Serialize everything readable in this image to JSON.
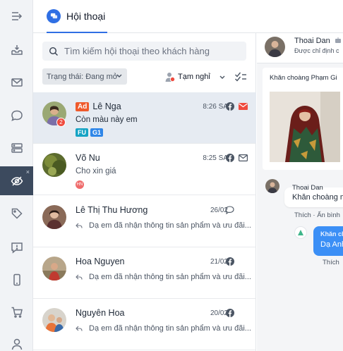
{
  "header": {
    "tab_label": "Hội thoại"
  },
  "sidebar": {
    "items": [
      {
        "icon": "collapse-menu-icon"
      },
      {
        "icon": "inbox-icon"
      },
      {
        "icon": "mail-icon"
      },
      {
        "icon": "chat-bubble-icon"
      },
      {
        "icon": "server-icon"
      },
      {
        "icon": "eye-off-icon",
        "active": true,
        "close": "×"
      },
      {
        "icon": "tag-icon"
      },
      {
        "icon": "feedback-icon"
      },
      {
        "icon": "mobile-icon"
      },
      {
        "icon": "cart-icon"
      },
      {
        "icon": "user-icon"
      }
    ]
  },
  "filters": {
    "search_placeholder": "Tìm kiếm hội thoại theo khách hàng",
    "status_label": "Trạng thái: Đang mở",
    "rest_label": "Tạm nghỉ"
  },
  "conversations": [
    {
      "name": "Lê Nga",
      "ad": "Ad",
      "time": "8:26 SA",
      "preview": "Còn màu này em",
      "badge": "2",
      "channel": "facebook-icon",
      "tags": [
        {
          "label": "FU",
          "color": "#16a3c4"
        },
        {
          "label": "G1",
          "color": "#2f86e8"
        }
      ],
      "mail_color": "#ef4b3f"
    },
    {
      "name": "Võ Nu",
      "time": "8:25 SA",
      "preview": "Cho xin giá",
      "tag_hn": "HN",
      "channel": "facebook-icon"
    },
    {
      "name": "Lê Thị Thu Hương",
      "time": "26/02",
      "preview": "Dạ em đã nhận thông tin sản phẩm và ưu đãi...",
      "channel": "comment-icon"
    },
    {
      "name": "Hoa Nguyen",
      "time": "21/02",
      "preview": "Dạ em đã nhận thông tin sản phẩm và ưu đãi...",
      "channel": "facebook-icon"
    },
    {
      "name": "Nguyên Hoa",
      "time": "20/02",
      "preview": "Dạ em đã nhận thông tin sản phẩm và ưu đãi...",
      "channel": "facebook-icon"
    }
  ],
  "detail": {
    "name": "Thoai Dan",
    "subtitle": "Được chỉ định c",
    "product_title": "Khăn choàng Phạm Gi",
    "message": {
      "sender": "Thoai Dan",
      "text": "Khăn choàng m",
      "actions": "Thích · Ẩn bình"
    },
    "reply": {
      "label": "Khăn ch",
      "text": "Dạ Anh",
      "like": "Thích"
    }
  },
  "colors": {
    "accent": "#2f6fe4",
    "selected_row": "#e6ebf2",
    "rail": "#f1f3f6",
    "rail_active": "#3c4a5e"
  }
}
